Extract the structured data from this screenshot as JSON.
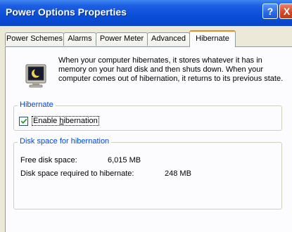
{
  "window": {
    "title": "Power Options Properties"
  },
  "titlebar": {
    "help_glyph": "?",
    "close_glyph": "X"
  },
  "tabs": [
    {
      "label": "Power Schemes"
    },
    {
      "label": "Alarms"
    },
    {
      "label": "Power Meter"
    },
    {
      "label": "Advanced"
    },
    {
      "label": "Hibernate",
      "active": true
    }
  ],
  "description": {
    "icon": "hibernate-monitor-icon",
    "text": "When your computer hibernates, it stores whatever it has in memory on your hard disk and then shuts down. When your computer comes out of hibernation, it returns to its previous state."
  },
  "hibernate_group": {
    "label": "Hibernate",
    "enable_checkbox": {
      "label": "Enable hibernation",
      "checked": true,
      "mnemonic": "h"
    }
  },
  "disk_group": {
    "label": "Disk space for hibernation",
    "free_label": "Free disk space:",
    "free_value": "6,015 MB",
    "required_label": "Disk space required to hibernate:",
    "required_value": "248 MB"
  },
  "colors": {
    "group_label": "#0046d5",
    "active_tab_accent": "#e68b2c",
    "titlebar": "#0a4ed8"
  }
}
